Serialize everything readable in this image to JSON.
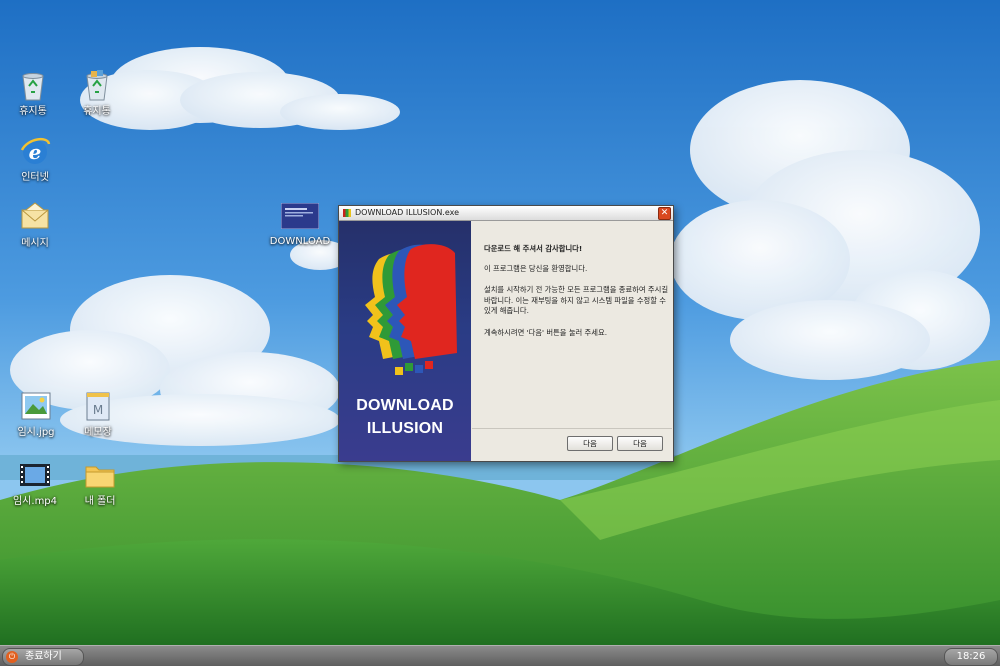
{
  "desktop": {
    "icons": [
      {
        "label": "휴지통",
        "icon": "recycle-bin-icon"
      },
      {
        "label": "휴지통",
        "icon": "recycle-bin-full-icon"
      },
      {
        "label": "인터넷",
        "icon": "internet-explorer-icon"
      },
      {
        "label": "메시지",
        "icon": "mail-envelope-icon"
      },
      {
        "label": "DOWNLOAD",
        "icon": "installer-thumbnail-icon"
      },
      {
        "label": "임시.jpg",
        "icon": "image-file-icon"
      },
      {
        "label": "메모장",
        "icon": "notepad-icon"
      },
      {
        "label": "임시.mp4",
        "icon": "video-file-icon"
      },
      {
        "label": "내 폴더",
        "icon": "folder-icon"
      }
    ]
  },
  "installer": {
    "title": "DOWNLOAD ILLUSION.exe",
    "close_glyph": "✕",
    "brand_line1": "DOWNLOAD",
    "brand_line2": "ILLUSION",
    "paragraphs": [
      "다운로드 해 주셔서 감사합니다!",
      "이 프로그램은 당신을 환영합니다.",
      "설치를 시작하기 전 가능한 모든 프로그램을 종료하여 주시길 바랍니다. 이는 재부팅을 하지 않고 시스템 파일을 수정할 수 있게 해줍니다.",
      "계속하시려면 '다음' 버튼을 눌러 주세요."
    ],
    "buttons": {
      "decoy": "다음",
      "next": "다음"
    }
  },
  "taskbar": {
    "start_label": "종료하기",
    "clock": "18:26"
  },
  "colors": {
    "banner": "#2a3c85",
    "taskbar": "#6e6e6e",
    "close": "#d9481f"
  }
}
